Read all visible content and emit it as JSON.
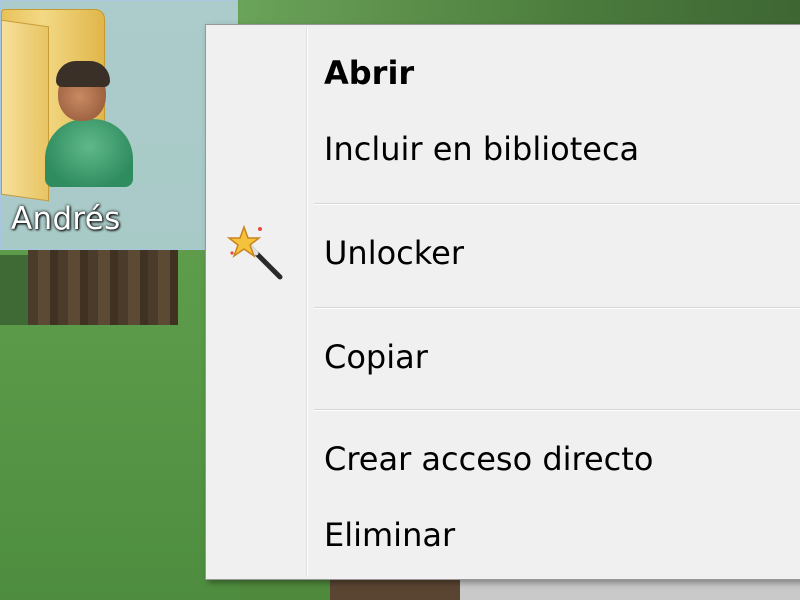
{
  "desktop": {
    "icon_label": "Andrés"
  },
  "context_menu": {
    "items": [
      {
        "label": "Abrir",
        "default": true
      },
      {
        "label": "Incluir en biblioteca"
      },
      {
        "label": "Unlocker",
        "icon": "magic-wand-icon"
      },
      {
        "label": "Copiar"
      },
      {
        "label": "Crear acceso directo"
      },
      {
        "label": "Eliminar"
      }
    ]
  }
}
